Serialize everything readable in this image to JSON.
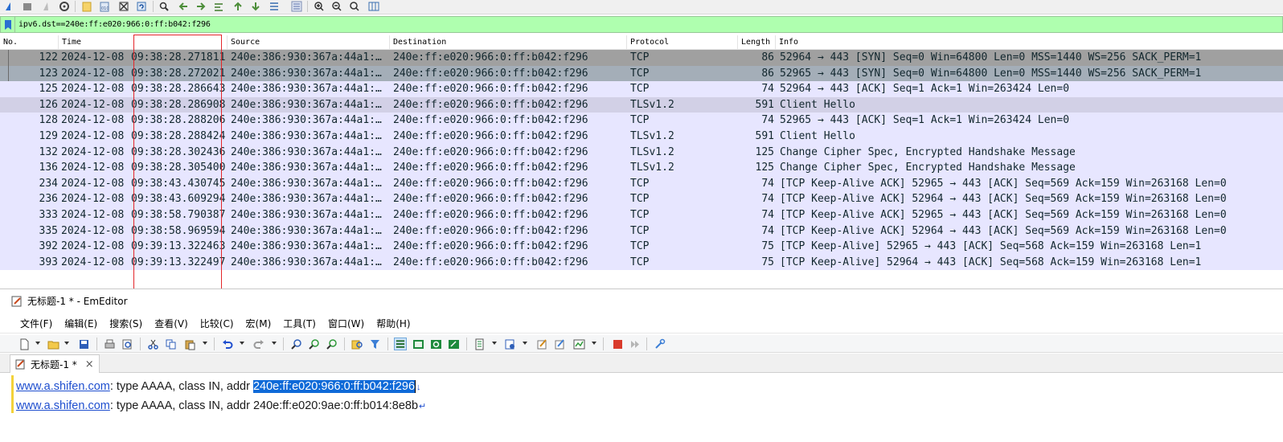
{
  "wireshark": {
    "filter": "ipv6.dst==240e:ff:e020:966:0:ff:b042:f296",
    "columns": [
      "No.",
      "Time",
      "Source",
      "Destination",
      "Protocol",
      "Length",
      "Info"
    ],
    "packets": [
      {
        "no": "122",
        "date": "2024-12-08",
        "time": "09:38:28.271811",
        "src": "240e:386:930:367a:44a1:…",
        "dst": "240e:ff:e020:966:0:ff:b042:f296",
        "proto": "TCP",
        "len": "86",
        "info": "52964 → 443 [SYN] Seq=0 Win=64800 Len=0 MSS=1440 WS=256 SACK_PERM=1"
      },
      {
        "no": "123",
        "date": "2024-12-08",
        "time": "09:38:28.272021",
        "src": "240e:386:930:367a:44a1:…",
        "dst": "240e:ff:e020:966:0:ff:b042:f296",
        "proto": "TCP",
        "len": "86",
        "info": "52965 → 443 [SYN] Seq=0 Win=64800 Len=0 MSS=1440 WS=256 SACK_PERM=1"
      },
      {
        "no": "125",
        "date": "2024-12-08",
        "time": "09:38:28.286643",
        "src": "240e:386:930:367a:44a1:…",
        "dst": "240e:ff:e020:966:0:ff:b042:f296",
        "proto": "TCP",
        "len": "74",
        "info": "52964 → 443 [ACK] Seq=1 Ack=1 Win=263424 Len=0"
      },
      {
        "no": "126",
        "date": "2024-12-08",
        "time": "09:38:28.286908",
        "src": "240e:386:930:367a:44a1:…",
        "dst": "240e:ff:e020:966:0:ff:b042:f296",
        "proto": "TLSv1.2",
        "len": "591",
        "info": "Client Hello"
      },
      {
        "no": "128",
        "date": "2024-12-08",
        "time": "09:38:28.288206",
        "src": "240e:386:930:367a:44a1:…",
        "dst": "240e:ff:e020:966:0:ff:b042:f296",
        "proto": "TCP",
        "len": "74",
        "info": "52965 → 443 [ACK] Seq=1 Ack=1 Win=263424 Len=0"
      },
      {
        "no": "129",
        "date": "2024-12-08",
        "time": "09:38:28.288424",
        "src": "240e:386:930:367a:44a1:…",
        "dst": "240e:ff:e020:966:0:ff:b042:f296",
        "proto": "TLSv1.2",
        "len": "591",
        "info": "Client Hello"
      },
      {
        "no": "132",
        "date": "2024-12-08",
        "time": "09:38:28.302436",
        "src": "240e:386:930:367a:44a1:…",
        "dst": "240e:ff:e020:966:0:ff:b042:f296",
        "proto": "TLSv1.2",
        "len": "125",
        "info": "Change Cipher Spec, Encrypted Handshake Message"
      },
      {
        "no": "136",
        "date": "2024-12-08",
        "time": "09:38:28.305400",
        "src": "240e:386:930:367a:44a1:…",
        "dst": "240e:ff:e020:966:0:ff:b042:f296",
        "proto": "TLSv1.2",
        "len": "125",
        "info": "Change Cipher Spec, Encrypted Handshake Message"
      },
      {
        "no": "234",
        "date": "2024-12-08",
        "time": "09:38:43.430745",
        "src": "240e:386:930:367a:44a1:…",
        "dst": "240e:ff:e020:966:0:ff:b042:f296",
        "proto": "TCP",
        "len": "74",
        "info": "[TCP Keep-Alive ACK] 52965 → 443 [ACK] Seq=569 Ack=159 Win=263168 Len=0"
      },
      {
        "no": "236",
        "date": "2024-12-08",
        "time": "09:38:43.609294",
        "src": "240e:386:930:367a:44a1:…",
        "dst": "240e:ff:e020:966:0:ff:b042:f296",
        "proto": "TCP",
        "len": "74",
        "info": "[TCP Keep-Alive ACK] 52964 → 443 [ACK] Seq=569 Ack=159 Win=263168 Len=0"
      },
      {
        "no": "333",
        "date": "2024-12-08",
        "time": "09:38:58.790387",
        "src": "240e:386:930:367a:44a1:…",
        "dst": "240e:ff:e020:966:0:ff:b042:f296",
        "proto": "TCP",
        "len": "74",
        "info": "[TCP Keep-Alive ACK] 52965 → 443 [ACK] Seq=569 Ack=159 Win=263168 Len=0"
      },
      {
        "no": "335",
        "date": "2024-12-08",
        "time": "09:38:58.969594",
        "src": "240e:386:930:367a:44a1:…",
        "dst": "240e:ff:e020:966:0:ff:b042:f296",
        "proto": "TCP",
        "len": "74",
        "info": "[TCP Keep-Alive ACK] 52964 → 443 [ACK] Seq=569 Ack=159 Win=263168 Len=0"
      },
      {
        "no": "392",
        "date": "2024-12-08",
        "time": "09:39:13.322463",
        "src": "240e:386:930:367a:44a1:…",
        "dst": "240e:ff:e020:966:0:ff:b042:f296",
        "proto": "TCP",
        "len": "75",
        "info": "[TCP Keep-Alive] 52965 → 443 [ACK] Seq=568 Ack=159 Win=263168 Len=1"
      },
      {
        "no": "393",
        "date": "2024-12-08",
        "time": "09:39:13.322497",
        "src": "240e:386:930:367a:44a1:…",
        "dst": "240e:ff:e020:966:0:ff:b042:f296",
        "proto": "TCP",
        "len": "75",
        "info": "[TCP Keep-Alive] 52964 → 443 [ACK] Seq=568 Ack=159 Win=263168 Len=1"
      }
    ],
    "colors": {
      "filter_bg": "#afffaf",
      "row_bg": "#e7e6ff",
      "row_selected": "#a0a0a0",
      "row_related": "#a4aeb8",
      "row_marked": "#d2d0e6",
      "annotation": "#e3262a"
    }
  },
  "emeditor": {
    "title": "无标题-1 * - EmEditor",
    "menu": [
      "文件(F)",
      "编辑(E)",
      "搜索(S)",
      "查看(V)",
      "比较(C)",
      "宏(M)",
      "工具(T)",
      "窗口(W)",
      "帮助(H)"
    ],
    "tab": "无标题-1 *",
    "tab_close": "×",
    "lines": [
      {
        "host": "www.a.shifen.com",
        "text": ": type AAAA, class IN, addr ",
        "addr": "240e:ff:e020:966:0:ff:b042:f296",
        "eol": "↓",
        "selected": true
      },
      {
        "host": "www.a.shifen.com",
        "text": ": type AAAA, class IN, addr ",
        "addr": "240e:ff:e020:9ae:0:ff:b014:8e8b",
        "eol": "↵",
        "selected": false
      }
    ],
    "colors": {
      "link": "#1f4fcf",
      "selection": "#0f6ad8",
      "gutter_mark": "#f3d23a"
    }
  }
}
